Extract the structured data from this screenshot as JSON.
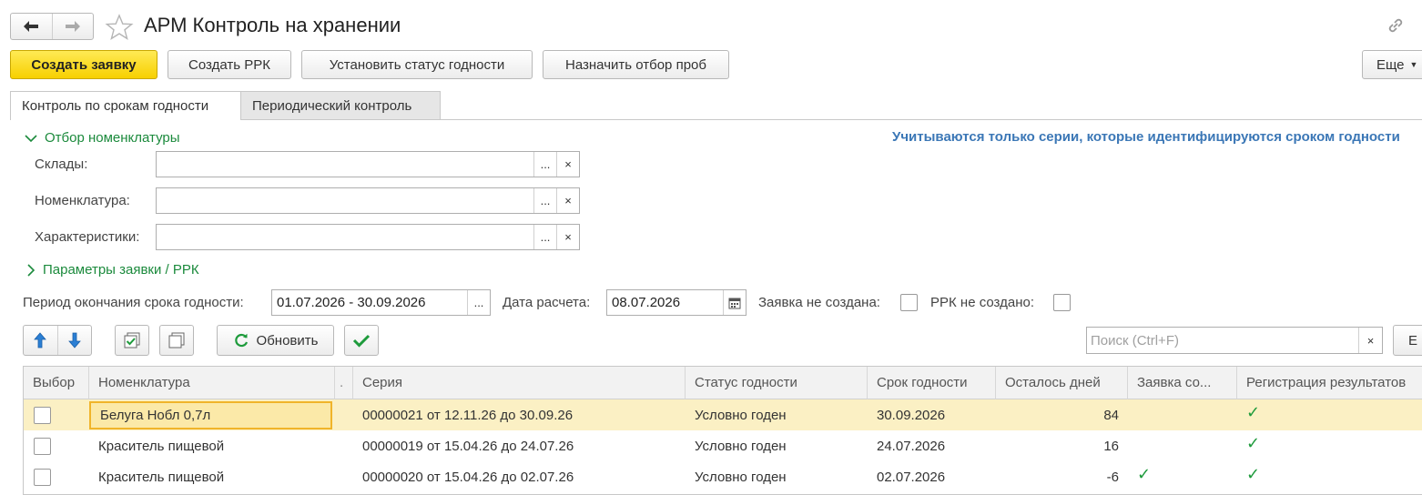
{
  "window": {
    "title": "АРМ Контроль на хранении"
  },
  "toolbar": {
    "create_request": "Создать заявку",
    "create_rrk": "Создать РРК",
    "set_status": "Установить статус годности",
    "assign_sampling": "Назначить отбор проб",
    "more": "Еще"
  },
  "tabs": [
    {
      "label": "Контроль по срокам годности",
      "active": true
    },
    {
      "label": "Периодический контроль",
      "active": false
    }
  ],
  "filter": {
    "group_title": "Отбор номенклатуры",
    "warehouses_label": "Склады:",
    "warehouses_value": "",
    "nomenclature_label": "Номенклатура:",
    "nomenclature_value": "",
    "characteristics_label": "Характеристики:",
    "characteristics_value": "",
    "choose_btn": "...",
    "clear_btn": "×"
  },
  "hint": "Учитываются только серии, которые идентифицируются сроком годности",
  "params_group_title": "Параметры заявки / РРК",
  "period": {
    "label": "Период окончания срока годности:",
    "value": "01.07.2026 - 30.09.2026",
    "btn": "..."
  },
  "calc_date": {
    "label": "Дата расчета:",
    "value": "08.07.2026"
  },
  "flags": {
    "request_not_created": "Заявка не создана:",
    "rrk_not_created": "РРК не создано:"
  },
  "table_toolbar": {
    "refresh": "Обновить",
    "search_placeholder": "Поиск (Ctrl+F)",
    "more_partial": "Е"
  },
  "table": {
    "columns": [
      "Выбор",
      "Номенклатура",
      "Серия",
      "Статус годности",
      "Срок годности",
      "Осталось дней",
      "Заявка со...",
      "Регистрация результатов"
    ],
    "sort_marker": ".",
    "rows": [
      {
        "nomenclature": "Белуга Нобл 0,7л",
        "series": "00000021 от 12.11.26 до 30.09.26",
        "status": "Условно годен",
        "expiry": "30.09.2026",
        "days_left": "84",
        "request": false,
        "registration": true,
        "selected": true
      },
      {
        "nomenclature": "Краситель пищевой",
        "series": "00000019 от 15.04.26 до 24.07.26",
        "status": "Условно годен",
        "expiry": "24.07.2026",
        "days_left": "16",
        "request": false,
        "registration": true,
        "selected": false
      },
      {
        "nomenclature": "Краситель пищевой",
        "series": "00000020 от 15.04.26 до 02.07.26",
        "status": "Условно годен",
        "expiry": "02.07.2026",
        "days_left": "-6",
        "request": true,
        "registration": true,
        "selected": false
      }
    ]
  },
  "colors": {
    "primary_button": "#f7d000",
    "group_header": "#1b8a3c",
    "hint_text": "#3b77b6",
    "selected_row": "#fbf0c4",
    "check_mark": "#1e9b3c",
    "arrow_blue": "#2b7fd4"
  },
  "icons": {
    "back": "arrow-left-icon",
    "forward": "arrow-right-icon",
    "favorite": "star-icon",
    "link": "link-icon",
    "expand": "chevron-down-icon",
    "collapsed": "chevron-right-icon",
    "calendar": "calendar-icon",
    "move_up": "arrow-up-icon",
    "move_down": "arrow-down-icon",
    "check_all": "check-all-icon",
    "uncheck_all": "uncheck-all-icon",
    "refresh": "refresh-icon",
    "apply": "check-icon"
  }
}
